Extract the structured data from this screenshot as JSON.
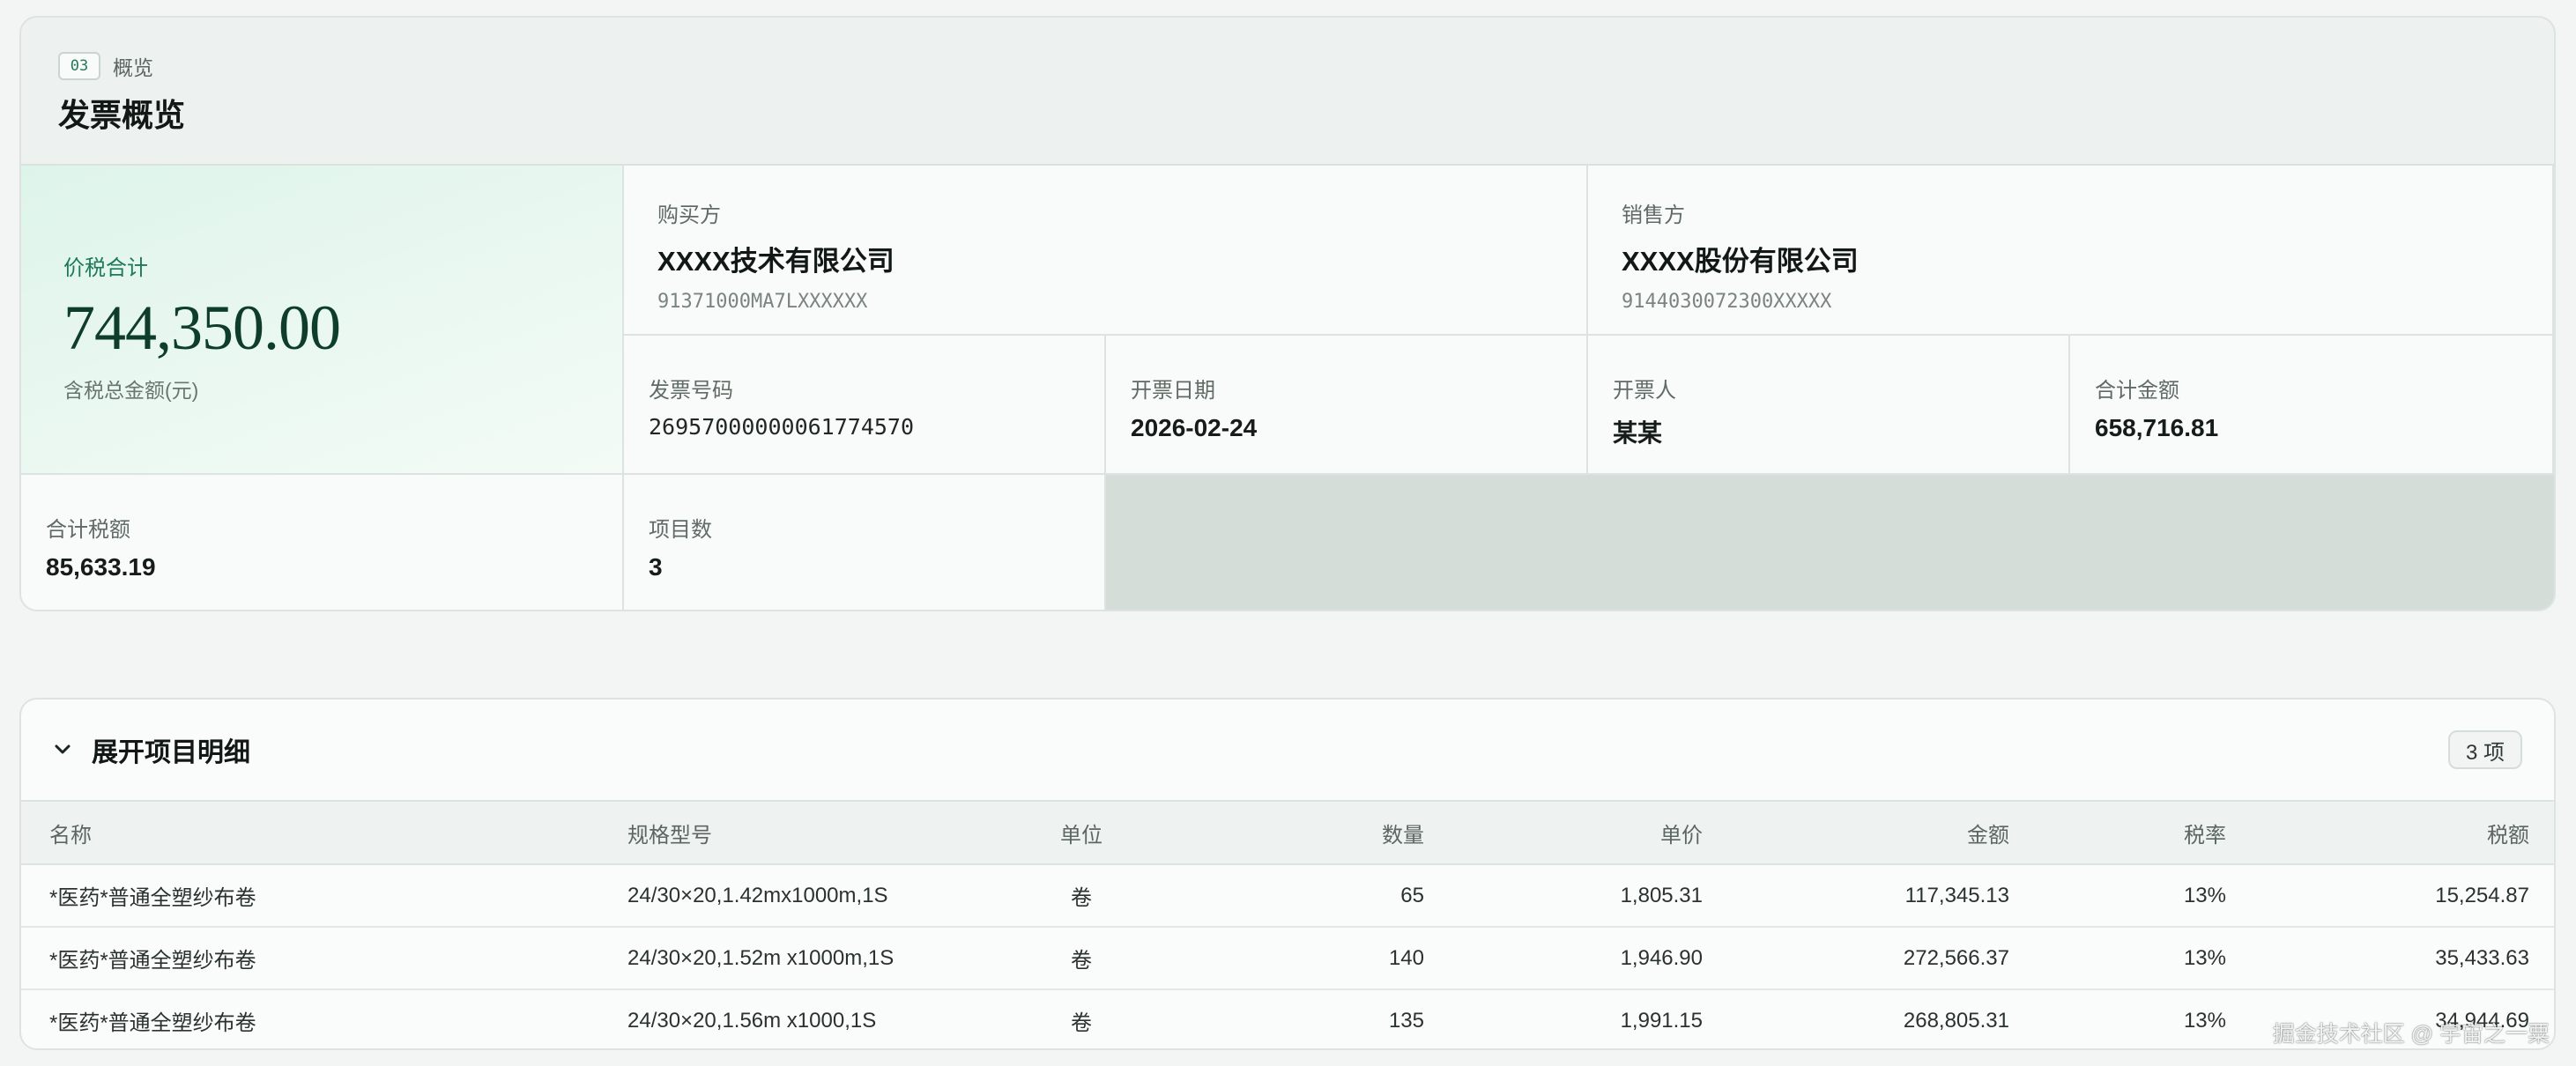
{
  "overview": {
    "step_badge": "03",
    "step_label": "概览",
    "title": "发票概览",
    "total": {
      "label": "价税合计",
      "value": "744,350.00",
      "sub": "含税总金额(元)"
    },
    "buyer": {
      "label": "购买方",
      "name": "XXXX技术有限公司",
      "tax_id": "91371000MA7LXXXXXX"
    },
    "seller": {
      "label": "销售方",
      "name": "XXXX股份有限公司",
      "tax_id": "9144030072300XXXXX"
    },
    "fields": {
      "invoice_no": {
        "label": "发票号码",
        "value": "26957000000061774570"
      },
      "date": {
        "label": "开票日期",
        "value": "2026-02-24"
      },
      "issuer": {
        "label": "开票人",
        "value": "某某"
      },
      "amount": {
        "label": "合计金额",
        "value": "658,716.81"
      },
      "tax": {
        "label": "合计税额",
        "value": "85,633.19"
      },
      "item_count": {
        "label": "项目数",
        "value": "3"
      }
    }
  },
  "details": {
    "title": "展开项目明细",
    "count_badge": "3 项",
    "columns": [
      "名称",
      "规格型号",
      "单位",
      "数量",
      "单价",
      "金额",
      "税率",
      "税额"
    ],
    "rows": [
      [
        "*医药*普通全塑纱布卷",
        "24/30×20,1.42mx1000m,1S",
        "卷",
        "65",
        "1,805.31",
        "117,345.13",
        "13%",
        "15,254.87"
      ],
      [
        "*医药*普通全塑纱布卷",
        "24/30×20,1.52m x1000m,1S",
        "卷",
        "140",
        "1,946.90",
        "272,566.37",
        "13%",
        "35,433.63"
      ],
      [
        "*医药*普通全塑纱布卷",
        "24/30×20,1.56m x1000,1S",
        "卷",
        "135",
        "1,991.15",
        "268,805.31",
        "13%",
        "34,944.69"
      ]
    ]
  },
  "watermark": "掘金技术社区 @ 宇宙之一粟",
  "colors": {
    "accent": "#1d7a58",
    "total_value": "#0e3d2d",
    "card_bg": "#edf1ef"
  }
}
